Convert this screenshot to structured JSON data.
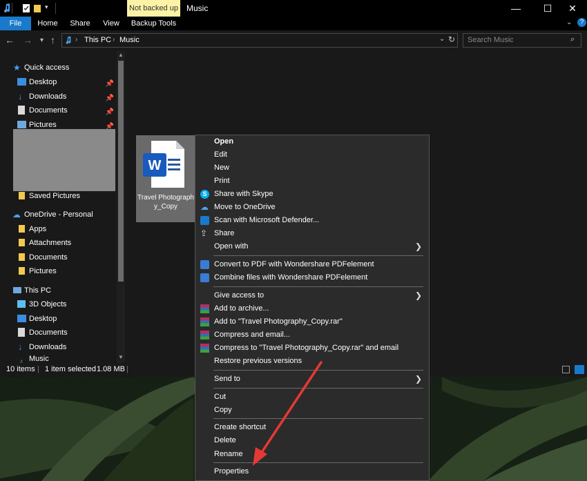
{
  "titlebar": {
    "not_backed_up": "Not backed up",
    "window_title": "Music",
    "minimize": "—",
    "maximize": "☐",
    "close": "✕"
  },
  "ribbon": {
    "tabs": [
      "File",
      "Home",
      "Share",
      "View",
      "Backup Tools"
    ]
  },
  "address": {
    "crumbs": [
      "This PC",
      "Music"
    ],
    "search_placeholder": "Search Music"
  },
  "nav": {
    "quick_access": "Quick access",
    "items": [
      {
        "label": "Desktop",
        "pinned": true
      },
      {
        "label": "Downloads",
        "pinned": true
      },
      {
        "label": "Documents",
        "pinned": true
      },
      {
        "label": "Pictures",
        "pinned": true
      }
    ],
    "saved_pictures": "Saved Pictures",
    "onedrive": "OneDrive - Personal",
    "onedrive_items": [
      "Apps",
      "Attachments",
      "Documents",
      "Pictures"
    ],
    "this_pc": "This PC",
    "pc_items": [
      "3D Objects",
      "Desktop",
      "Documents",
      "Downloads",
      "Music"
    ]
  },
  "file": {
    "name": "Travel Photography_Copy"
  },
  "status": {
    "items": "10 items",
    "selected": "1 item selected",
    "size": "1.08 MB"
  },
  "menu": {
    "open": "Open",
    "edit": "Edit",
    "new": "New",
    "print": "Print",
    "skype": "Share with Skype",
    "onedrive": "Move to OneDrive",
    "defender": "Scan with Microsoft Defender...",
    "share": "Share",
    "open_with": "Open with",
    "convert_pdf": "Convert to PDF with Wondershare PDFelement",
    "combine": "Combine files with Wondershare PDFelement",
    "give_access": "Give access to",
    "add_archive": "Add to archive...",
    "add_rar": "Add to \"Travel Photography_Copy.rar\"",
    "compress_email": "Compress and email...",
    "compress_rar_email": "Compress to \"Travel Photography_Copy.rar\" and email",
    "restore": "Restore previous versions",
    "send_to": "Send to",
    "cut": "Cut",
    "copy": "Copy",
    "create_shortcut": "Create shortcut",
    "delete": "Delete",
    "rename": "Rename",
    "properties": "Properties"
  },
  "colors": {
    "accent": "#1979ca",
    "arrow": "#e53935",
    "menu_bg": "#2b2b2b",
    "folder": "#f2c94c"
  }
}
